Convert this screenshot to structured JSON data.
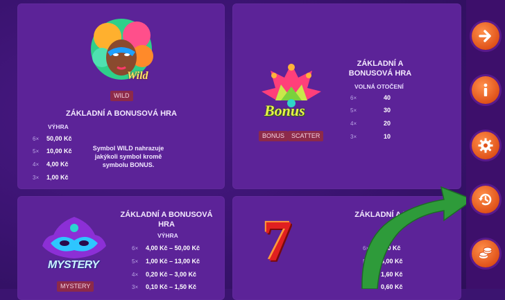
{
  "card_wild": {
    "badges": [
      "WILD"
    ],
    "title": "ZÁKLADNÍ A BONUSOVÁ HRA",
    "subhead": "VÝHRA",
    "rows": [
      {
        "mult": "6×",
        "value": "50,00 Kč"
      },
      {
        "mult": "5×",
        "value": "10,00 Kč"
      },
      {
        "mult": "4×",
        "value": "4,00 Kč"
      },
      {
        "mult": "3×",
        "value": "1,00 Kč"
      }
    ],
    "description": "Symbol WILD nahrazuje jakýkoli symbol kromě symbolu BONUS.",
    "symbol_text": "Wild"
  },
  "card_bonus": {
    "badges": [
      "BONUS",
      "SCATTER"
    ],
    "title": "ZÁKLADNÍ A BONUSOVÁ HRA",
    "subhead": "VOLNÁ OTOČENÍ",
    "rows": [
      {
        "mult": "6×",
        "value": "40"
      },
      {
        "mult": "5×",
        "value": "30"
      },
      {
        "mult": "4×",
        "value": "20"
      },
      {
        "mult": "3×",
        "value": "10"
      }
    ],
    "symbol_text": "Bonus"
  },
  "card_mystery": {
    "badges": [
      "MYSTERY"
    ],
    "title": "ZÁKLADNÍ A BONUSOVÁ HRA",
    "subhead": "VÝHRA",
    "rows": [
      {
        "mult": "6×",
        "value": "4,00 Kč – 50,00 Kč"
      },
      {
        "mult": "5×",
        "value": "1,00 Kč – 13,00 Kč"
      },
      {
        "mult": "4×",
        "value": "0,20 Kč – 3,00 Kč"
      },
      {
        "mult": "3×",
        "value": "0,10 Kč – 1,50 Kč"
      }
    ],
    "symbol_text": "MYSTERY"
  },
  "card_seven": {
    "title": "ZÁKLADNÍ A B",
    "rows": [
      {
        "mult": "6×",
        "value": "20,00 Kč"
      },
      {
        "mult": "5×",
        "value": "6,00 Kč"
      },
      {
        "mult": "4×",
        "value": "1,60 Kč"
      },
      {
        "mult": "3×",
        "value": "0,60 Kč"
      }
    ],
    "symbol_text": "7"
  },
  "sidebar": {
    "buttons": [
      {
        "icon": "arrow-right-icon"
      },
      {
        "icon": "info-icon"
      },
      {
        "icon": "gear-icon"
      },
      {
        "icon": "history-icon"
      },
      {
        "icon": "coins-icon"
      }
    ]
  },
  "colors": {
    "background": "#3b1470",
    "card": "#5c2398",
    "badge": "#8c2a4a",
    "button_orange": "#e0531a",
    "annotation_arrow": "#2e9b3a"
  }
}
